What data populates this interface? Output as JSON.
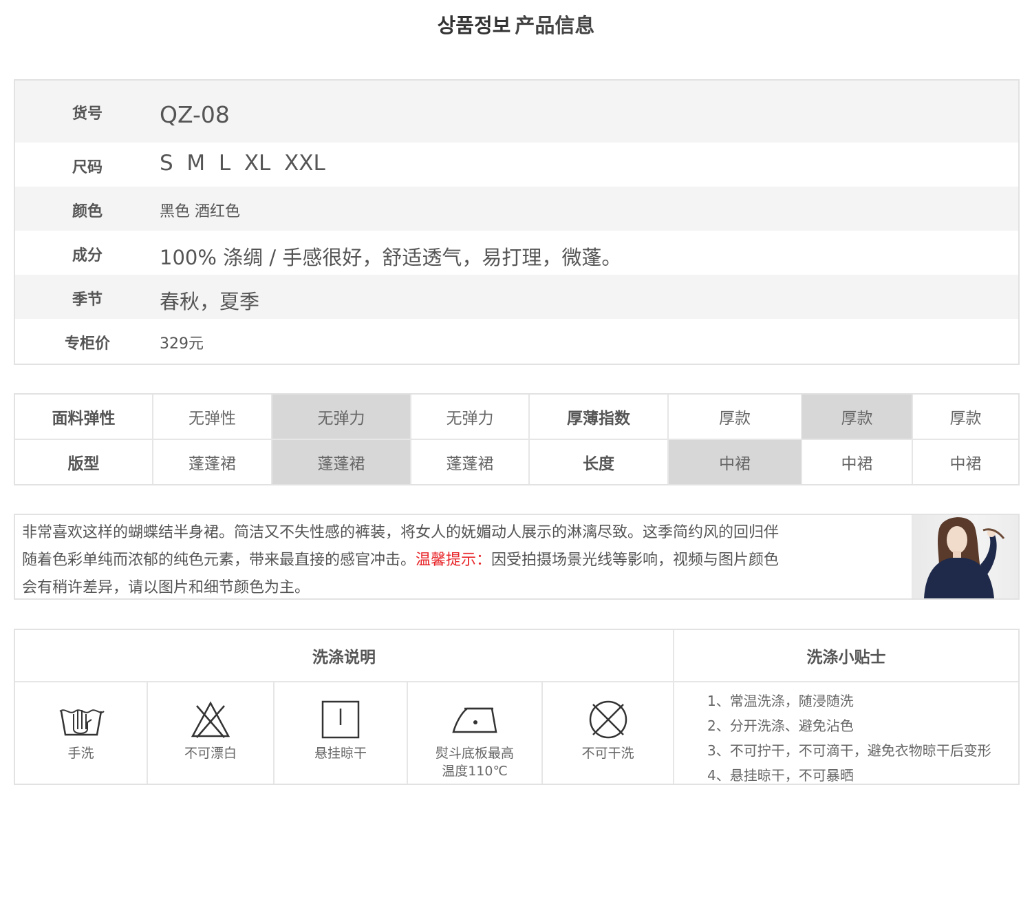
{
  "header": {
    "title_ko": "상품정보",
    "title_zh": "产品信息"
  },
  "info": [
    {
      "label": "货号",
      "value": "QZ-08"
    },
    {
      "label": "尺码",
      "value": "S  M  L  XL  XXL"
    },
    {
      "label": "颜色",
      "value": "黑色 酒红色"
    },
    {
      "label": "成分",
      "value": "100% 涤绸 / 手感很好，舒适透气，易打理，微蓬。"
    },
    {
      "label": "季节",
      "value": "春秋，夏季"
    },
    {
      "label": "专柜价",
      "value": "329元"
    }
  ],
  "attrs": {
    "row1": {
      "label": "面料弹性",
      "opts": [
        "无弹性",
        "无弹力",
        "无弹力"
      ],
      "label2": "厚薄指数",
      "opts2": [
        "厚款",
        "厚款",
        "厚款"
      ]
    },
    "row2": {
      "label": "版型",
      "opts": [
        "蓬蓬裙",
        "蓬蓬裙",
        "蓬蓬裙"
      ],
      "label2": "长度",
      "opts2": [
        "中裙",
        "中裙",
        "中裙"
      ]
    }
  },
  "description": {
    "line1": "非常喜欢这样的蝴蝶结半身裙。简洁又不失性感的裤装，将女人的妩媚动人展示的淋漓尽致。这季简约风的回归伴",
    "line2a": "随着色彩单纯而浓郁的纯色元素，带来最直接的感官冲击。",
    "line2_red": "温馨提示：",
    "line2b": "因受拍摄场景光线等影响，视频与图片颜色",
    "line3": "会有稍许差异，请以图片和细节颜色为主。"
  },
  "wash": {
    "head_left": "洗涤说明",
    "head_right": "洗涤小贴士",
    "icons": [
      {
        "icon": "hand-wash-icon",
        "label": "手洗"
      },
      {
        "icon": "no-bleach-icon",
        "label": "不可漂白"
      },
      {
        "icon": "hang-dry-icon",
        "label": "悬挂晾干"
      },
      {
        "icon": "iron-icon",
        "label": "熨斗底板最高",
        "label2": "温度110℃"
      },
      {
        "icon": "no-dry-clean-icon",
        "label": "不可干洗"
      }
    ],
    "tips": [
      "1、常温洗涤，随浸随洗",
      "2、分开洗涤、避免沾色",
      "3、不可拧干，不可滴干，避免衣物晾干后变形",
      "4、悬挂晾干，不可暴晒"
    ]
  }
}
